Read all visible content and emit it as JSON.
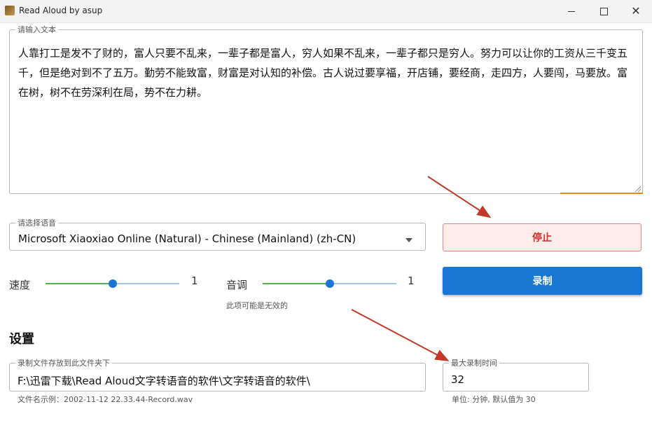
{
  "window": {
    "title": "Read Aloud by asup",
    "icon": "app-icon"
  },
  "text_input": {
    "label": "请输入文本",
    "value": "人靠打工是发不了财的，富人只要不乱来，一辈子都是富人，穷人如果不乱来，一辈子都只是穷人。努力可以让你的工资从三千变五千，但是绝对到不了五万。勤劳不能致富，财富是对认知的补偿。古人说过要享福，开店铺，要经商，走四方，人要闯，马要放。富在树，树不在劳深利在局，势不在力耕。"
  },
  "voice_select": {
    "label": "请选择语音",
    "value": "Microsoft Xiaoxiao Online (Natural) - Chinese (Mainland) (zh-CN)"
  },
  "speed": {
    "label": "速度",
    "value_text": "1",
    "level": 0.5
  },
  "pitch": {
    "label": "音调",
    "value_text": "1",
    "level": 0.5,
    "hint": "此项可能是无效的"
  },
  "buttons": {
    "stop": "停止",
    "record": "录制"
  },
  "settings": {
    "title": "设置",
    "folder_label": "录制文件存放到此文件夹下",
    "folder_value": "F:\\迅雷下载\\Read Aloud文字转语音的软件\\文字转语音的软件\\",
    "filename_example": "文件名示例：2002-11-12 22.33.44-Record.wav",
    "max_label": "最大录制时间",
    "max_value": "32",
    "max_hint": "单位: 分钟, 默认值为 30"
  },
  "colors": {
    "accent_blue": "#1976d2",
    "stop_red": "#d32f2f",
    "annotation_arrow": "#c0392b"
  }
}
